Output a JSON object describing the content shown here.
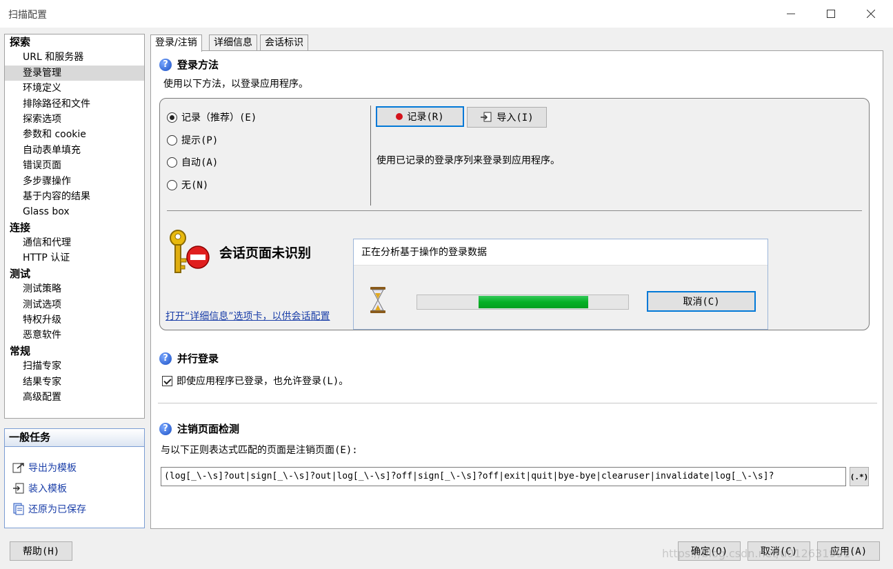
{
  "window": {
    "title": "扫描配置"
  },
  "nav": {
    "groups": [
      {
        "label": "探索",
        "items": [
          "URL 和服务器",
          "登录管理",
          "环境定义",
          "排除路径和文件",
          "探索选项",
          "参数和 cookie",
          "自动表单填充",
          "错误页面",
          "多步骤操作",
          "基于内容的结果",
          "Glass box"
        ]
      },
      {
        "label": "连接",
        "items": [
          "通信和代理",
          "HTTP 认证"
        ]
      },
      {
        "label": "测试",
        "items": [
          "测试策略",
          "测试选项",
          "特权升级",
          "恶意软件"
        ]
      },
      {
        "label": "常规",
        "items": [
          "扫描专家",
          "结果专家",
          "高级配置"
        ]
      }
    ],
    "selected": "登录管理"
  },
  "tasks": {
    "title": "一般任务",
    "items": [
      "导出为模板",
      "装入模板",
      "还原为已保存"
    ]
  },
  "tabs": [
    "登录/注销",
    "详细信息",
    "会话标识"
  ],
  "login": {
    "title": "登录方法",
    "desc": "使用以下方法，以登录应用程序。",
    "options": [
      "记录（推荐）(E)",
      "提示(P)",
      "自动(A)",
      "无(N)"
    ],
    "selected_option": 0,
    "record_button": "记录(R)",
    "import_button": "导入(I)",
    "record_desc": "使用已记录的登录序列来登录到应用程序。",
    "session_status": "会话页面未识别",
    "details_link": "打开“详细信息”选项卡，以供会话配置"
  },
  "parallel": {
    "title": "并行登录",
    "checkbox_label": "即使应用程序已登录，也允许登录(L)。",
    "checked": true
  },
  "logout": {
    "title": "注销页面检测",
    "desc": "与以下正则表达式匹配的页面是注销页面(E):",
    "regex": "(log[_\\-\\s]?out|sign[_\\-\\s]?out|log[_\\-\\s]?off|sign[_\\-\\s]?off|exit|quit|bye-bye|clearuser|invalidate|log[_\\-\\s]?",
    "regex_button": "(.*)"
  },
  "dialog": {
    "title": "正在分析基于操作的登录数据",
    "cancel": "取消(C)",
    "progress_start": 0.29,
    "progress_end": 0.81
  },
  "footer": {
    "help": "帮助(H)",
    "ok": "确定(O)",
    "cancel": "取消(C)",
    "apply": "应用(A)"
  },
  "watermark": "https://blog.csdn.net/u012631991"
}
